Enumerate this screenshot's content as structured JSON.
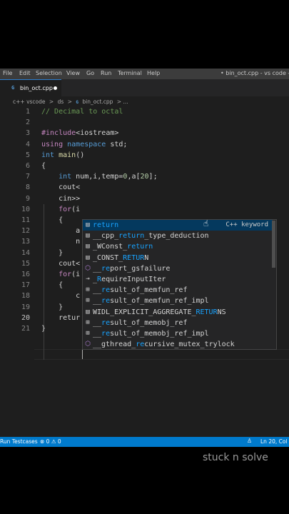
{
  "menubar": {
    "items": [
      "File",
      "Edit",
      "Selection",
      "View",
      "Go",
      "Run",
      "Terminal",
      "Help"
    ],
    "window_title": "• bin_oct.cpp - vs code - Visu"
  },
  "tab": {
    "icon": "G",
    "label": "bin_oct.cpp",
    "modified": true
  },
  "breadcrumb": {
    "parts": [
      "c++ vscode",
      ">",
      "ds",
      ">",
      "bin_oct.cpp",
      "> ..."
    ],
    "file_icon": "G"
  },
  "editor": {
    "lines": [
      {
        "n": "1",
        "tokens": [
          {
            "c": "cm",
            "t": "// Decimal to octal"
          }
        ]
      },
      {
        "n": "2",
        "tokens": []
      },
      {
        "n": "3",
        "tokens": [
          {
            "c": "pp",
            "t": "#include"
          },
          {
            "c": "tx",
            "t": "<iostream>"
          }
        ]
      },
      {
        "n": "4",
        "tokens": [
          {
            "c": "pp",
            "t": "using"
          },
          {
            "c": "tx",
            "t": " "
          },
          {
            "c": "kw",
            "t": "namespace"
          },
          {
            "c": "tx",
            "t": " std;"
          }
        ]
      },
      {
        "n": "5",
        "tokens": [
          {
            "c": "kw",
            "t": "int"
          },
          {
            "c": "tx",
            "t": " "
          },
          {
            "c": "fn",
            "t": "main"
          },
          {
            "c": "tx",
            "t": "()"
          }
        ]
      },
      {
        "n": "6",
        "tokens": [
          {
            "c": "tx",
            "t": "{"
          }
        ]
      },
      {
        "n": "7",
        "tokens": [
          {
            "c": "tx",
            "t": "    "
          },
          {
            "c": "kw",
            "t": "int"
          },
          {
            "c": "tx",
            "t": " num,i,temp="
          },
          {
            "c": "num",
            "t": "0"
          },
          {
            "c": "tx",
            "t": ",a["
          },
          {
            "c": "num",
            "t": "20"
          },
          {
            "c": "tx",
            "t": "];"
          }
        ]
      },
      {
        "n": "8",
        "tokens": [
          {
            "c": "tx",
            "t": "    cout<"
          }
        ]
      },
      {
        "n": "9",
        "tokens": [
          {
            "c": "tx",
            "t": "    cin>>"
          }
        ]
      },
      {
        "n": "10",
        "tokens": [
          {
            "c": "tx",
            "t": "    "
          },
          {
            "c": "pp",
            "t": "for"
          },
          {
            "c": "tx",
            "t": "(i"
          }
        ]
      },
      {
        "n": "11",
        "tokens": [
          {
            "c": "tx",
            "t": "    {"
          }
        ]
      },
      {
        "n": "12",
        "tokens": [
          {
            "c": "tx",
            "t": "        a"
          }
        ]
      },
      {
        "n": "13",
        "tokens": [
          {
            "c": "tx",
            "t": "        n"
          }
        ]
      },
      {
        "n": "14",
        "tokens": [
          {
            "c": "tx",
            "t": "    }"
          }
        ]
      },
      {
        "n": "15",
        "tokens": [
          {
            "c": "tx",
            "t": "    cout<"
          }
        ]
      },
      {
        "n": "16",
        "tokens": [
          {
            "c": "tx",
            "t": "    "
          },
          {
            "c": "pp",
            "t": "for"
          },
          {
            "c": "tx",
            "t": "(i"
          }
        ]
      },
      {
        "n": "17",
        "tokens": [
          {
            "c": "tx",
            "t": "    {"
          }
        ]
      },
      {
        "n": "18",
        "tokens": [
          {
            "c": "tx",
            "t": "        c"
          }
        ]
      },
      {
        "n": "19",
        "tokens": [
          {
            "c": "tx",
            "t": "    }"
          }
        ]
      },
      {
        "n": "20",
        "tokens": [
          {
            "c": "tx",
            "t": "    retur"
          }
        ],
        "active": true
      },
      {
        "n": "21",
        "tokens": [
          {
            "c": "tx",
            "t": "}"
          }
        ]
      }
    ]
  },
  "suggest": {
    "items": [
      {
        "icon": "keyword-icon",
        "glyph": "▤",
        "pre": "",
        "hl": "return",
        "post": "",
        "detail": "C++ keyword",
        "selected": true
      },
      {
        "icon": "keyword-icon",
        "glyph": "▤",
        "pre": "__cpp_",
        "hl": "return",
        "post": "_type_deduction",
        "detail": ""
      },
      {
        "icon": "keyword-icon",
        "glyph": "▤",
        "pre": "_WConst_",
        "hl": "return",
        "post": "",
        "detail": ""
      },
      {
        "icon": "keyword-icon",
        "glyph": "▤",
        "pre": "_CONST_",
        "hl": "RETUR",
        "post": "N",
        "detail": ""
      },
      {
        "icon": "method-icon",
        "glyph": "⬡",
        "purple": true,
        "pre": "__",
        "hl": "re",
        "post": "port_gsfailure",
        "detail": ""
      },
      {
        "icon": "field-icon",
        "glyph": "⊸",
        "pre": "_",
        "hl": "R",
        "post": "equireInputIter",
        "detail": ""
      },
      {
        "icon": "struct-icon",
        "glyph": "⊞",
        "pre": "__",
        "hl": "re",
        "post": "sult_of_memfun_ref",
        "detail": ""
      },
      {
        "icon": "struct-icon",
        "glyph": "⊞",
        "pre": "__",
        "hl": "re",
        "post": "sult_of_memfun_ref_impl",
        "detail": ""
      },
      {
        "icon": "keyword-icon",
        "glyph": "▤",
        "pre": "WIDL_EXPLICIT_AGGREGATE_",
        "hl": "RETUR",
        "post": "NS",
        "detail": ""
      },
      {
        "icon": "struct-icon",
        "glyph": "⊞",
        "pre": "__",
        "hl": "re",
        "post": "sult_of_memobj_ref",
        "detail": ""
      },
      {
        "icon": "struct-icon",
        "glyph": "⊞",
        "pre": "__",
        "hl": "re",
        "post": "sult_of_memobj_ref_impl",
        "detail": ""
      },
      {
        "icon": "method-icon",
        "glyph": "⬡",
        "purple": true,
        "pre": "__gthread_",
        "hl": "re",
        "post": "cursive_mutex_trylock",
        "detail": ""
      }
    ]
  },
  "statusbar": {
    "left": "Run Testcases",
    "problems": "⊗ 0 ⚠ 0",
    "position": "Ln 20, Col 1"
  },
  "watermark": "stuck n solve",
  "colors": {
    "accent": "#007acc",
    "suggest_selected": "#04395e",
    "match_highlight": "#18a3ff"
  }
}
